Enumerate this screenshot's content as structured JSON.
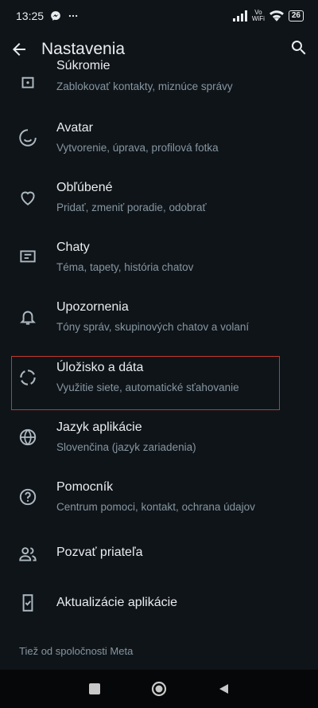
{
  "status_bar": {
    "time": "13:25",
    "volte": "Vo\nWiFi",
    "battery": "26"
  },
  "app_bar": {
    "title": "Nastavenia"
  },
  "items": [
    {
      "label": "Súkromie",
      "sub": "Zablokovať kontakty, miznúce správy",
      "icon": "lock-icon"
    },
    {
      "label": "Avatar",
      "sub": "Vytvorenie, úprava, profilová fotka",
      "icon": "avatar-icon"
    },
    {
      "label": "Obľúbené",
      "sub": "Pridať, zmeniť poradie, odobrať",
      "icon": "heart-icon"
    },
    {
      "label": "Chaty",
      "sub": "Téma, tapety, história chatov",
      "icon": "chat-icon"
    },
    {
      "label": "Upozornenia",
      "sub": "Tóny správ, skupinových chatov a volaní",
      "icon": "bell-icon"
    },
    {
      "label": "Úložisko a dáta",
      "sub": "Využitie siete, automatické sťahovanie",
      "icon": "storage-icon"
    },
    {
      "label": "Jazyk aplikácie",
      "sub": "Slovenčina (jazyk zariadenia)",
      "icon": "globe-icon"
    },
    {
      "label": "Pomocník",
      "sub": "Centrum pomoci, kontakt, ochrana údajov",
      "icon": "help-icon"
    },
    {
      "label": "Pozvať priateľa",
      "icon": "invite-icon"
    },
    {
      "label": "Aktualizácie aplikácie",
      "icon": "update-icon"
    }
  ],
  "footer": {
    "section_title": "Tiež od spoločnosti Meta"
  },
  "colors": {
    "background": "#0f1419",
    "text_primary": "#e9edef",
    "text_secondary": "#8696a0",
    "highlight_border": "#c0392b"
  }
}
